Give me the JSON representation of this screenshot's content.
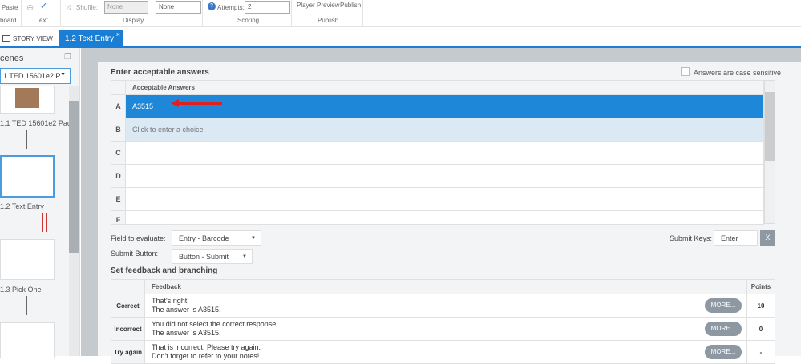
{
  "ribbon": {
    "paste": "Paste",
    "clipboard": "board",
    "text_group": "Text",
    "shuffle_label": "Shuffle:",
    "shuffle_value": "None",
    "display_value2": "None",
    "display_group": "Display",
    "attempts_label": "Attempts:",
    "attempts_value": "2",
    "scoring_group": "Scoring",
    "player": "Player",
    "preview": "Preview",
    "publish": "Publish",
    "publish_group": "Publish"
  },
  "tabs": {
    "story_view": "STORY VIEW",
    "active": "1.2 Text Entry",
    "close": "×"
  },
  "scenes": {
    "title": "cenes",
    "selected": "1 TED 15601e2 P",
    "slides": [
      {
        "label": "1.1 TED 15601e2 Pac..."
      },
      {
        "label": "1.2 Text Entry"
      },
      {
        "label": "1.3 Pick One"
      }
    ]
  },
  "answers": {
    "title": "Enter acceptable answers",
    "case_label": "Answers are case sensitive",
    "header": "Acceptable Answers",
    "rows": [
      {
        "letter": "A",
        "value": "A3515"
      },
      {
        "letter": "B",
        "value": "Click to enter a choice"
      },
      {
        "letter": "C",
        "value": ""
      },
      {
        "letter": "D",
        "value": ""
      },
      {
        "letter": "E",
        "value": ""
      },
      {
        "letter": "F",
        "value": ""
      }
    ]
  },
  "evaluate": {
    "field_label": "Field to evaluate:",
    "field_value": "Entry - Barcode",
    "submit_label": "Submit Button:",
    "submit_value": "Button - Submit",
    "keys_label": "Submit Keys:",
    "keys_value": "Enter",
    "clear": "X"
  },
  "feedback": {
    "title": "Set feedback and branching",
    "col_feedback": "Feedback",
    "col_points": "Points",
    "more": "MORE...",
    "rows": [
      {
        "label": "Correct",
        "line1": "That's right!",
        "line2": "The answer is A3515.",
        "points": "10"
      },
      {
        "label": "Incorrect",
        "line1": "You did not select the correct response.",
        "line2": "The answer is A3515.",
        "points": "0"
      },
      {
        "label": "Try again",
        "line1": "That is incorrect. Please try again.",
        "line2": "Don't forget to refer to your notes!",
        "points": "-"
      }
    ]
  },
  "colors": {
    "accent": "#1a7fd4",
    "selected_row": "#1e87d8",
    "arrow": "#e02020"
  }
}
